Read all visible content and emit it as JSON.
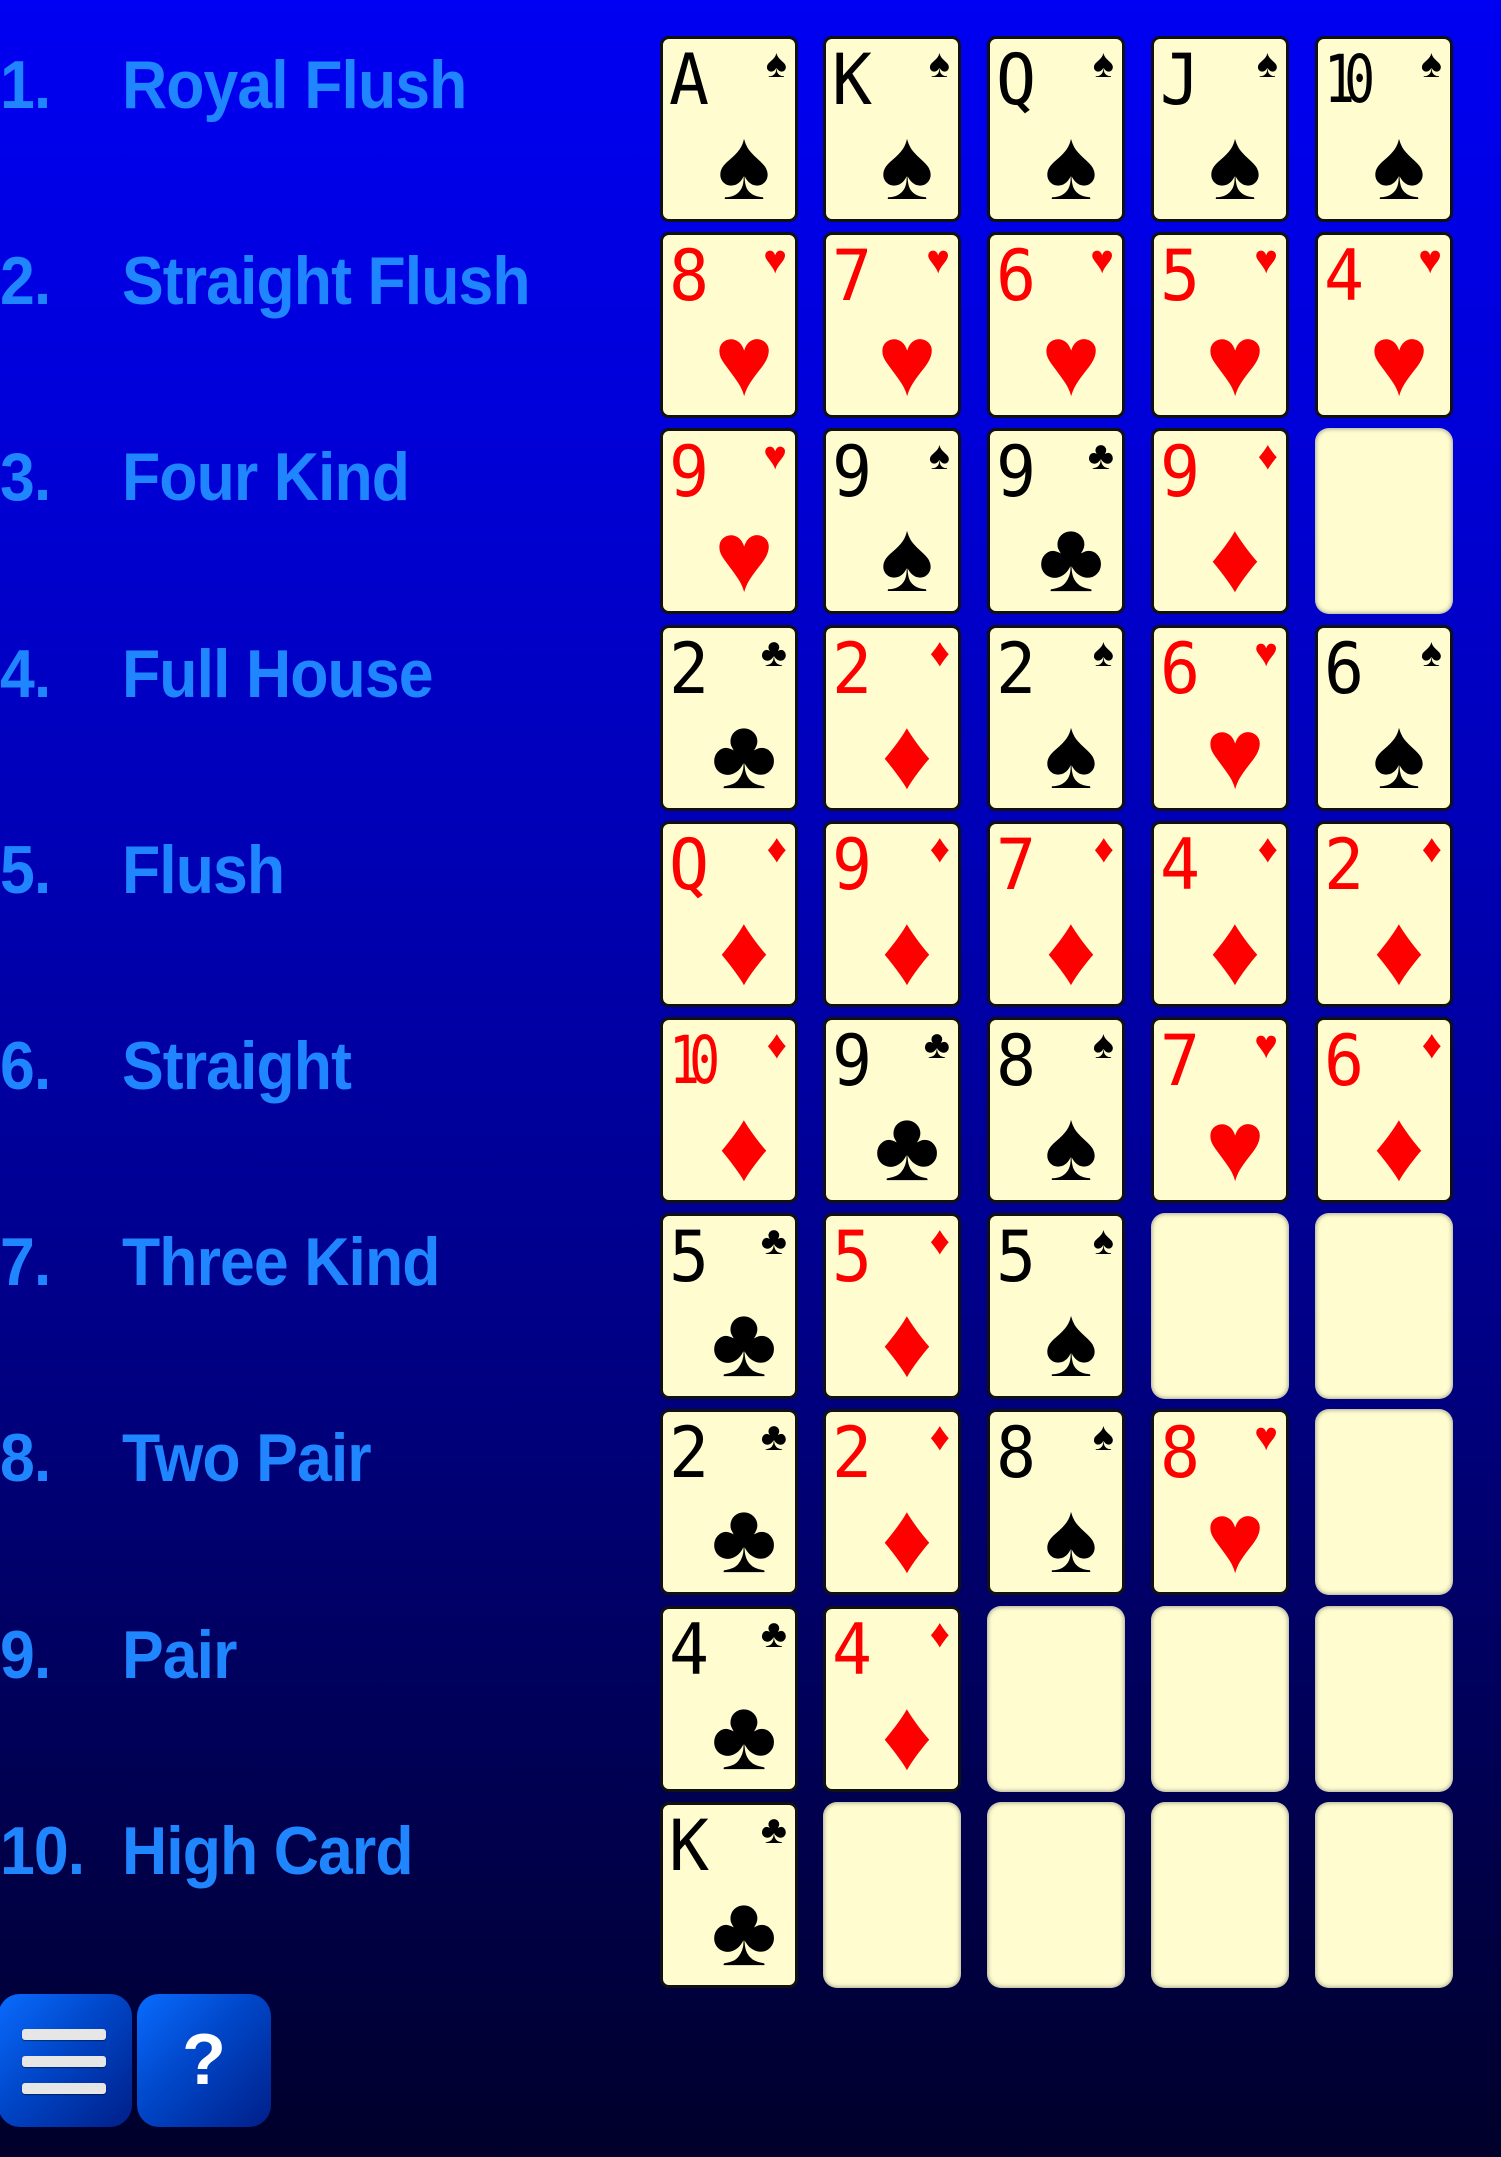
{
  "hands": [
    {
      "number": "1.",
      "name": "Royal Flush",
      "cards": [
        {
          "rank": "A",
          "suit": "spades"
        },
        {
          "rank": "K",
          "suit": "spades"
        },
        {
          "rank": "Q",
          "suit": "spades"
        },
        {
          "rank": "J",
          "suit": "spades"
        },
        {
          "rank": "10",
          "suit": "spades"
        }
      ]
    },
    {
      "number": "2.",
      "name": "Straight Flush",
      "cards": [
        {
          "rank": "8",
          "suit": "hearts"
        },
        {
          "rank": "7",
          "suit": "hearts"
        },
        {
          "rank": "6",
          "suit": "hearts"
        },
        {
          "rank": "5",
          "suit": "hearts"
        },
        {
          "rank": "4",
          "suit": "hearts"
        }
      ]
    },
    {
      "number": "3.",
      "name": "Four Kind",
      "cards": [
        {
          "rank": "9",
          "suit": "hearts"
        },
        {
          "rank": "9",
          "suit": "spades"
        },
        {
          "rank": "9",
          "suit": "clubs"
        },
        {
          "rank": "9",
          "suit": "diamonds"
        },
        null
      ]
    },
    {
      "number": "4.",
      "name": "Full House",
      "cards": [
        {
          "rank": "2",
          "suit": "clubs"
        },
        {
          "rank": "2",
          "suit": "diamonds"
        },
        {
          "rank": "2",
          "suit": "spades"
        },
        {
          "rank": "6",
          "suit": "hearts"
        },
        {
          "rank": "6",
          "suit": "spades"
        }
      ]
    },
    {
      "number": "5.",
      "name": "Flush",
      "cards": [
        {
          "rank": "Q",
          "suit": "diamonds"
        },
        {
          "rank": "9",
          "suit": "diamonds"
        },
        {
          "rank": "7",
          "suit": "diamonds"
        },
        {
          "rank": "4",
          "suit": "diamonds"
        },
        {
          "rank": "2",
          "suit": "diamonds"
        }
      ]
    },
    {
      "number": "6.",
      "name": "Straight",
      "cards": [
        {
          "rank": "10",
          "suit": "diamonds"
        },
        {
          "rank": "9",
          "suit": "clubs"
        },
        {
          "rank": "8",
          "suit": "spades"
        },
        {
          "rank": "7",
          "suit": "hearts"
        },
        {
          "rank": "6",
          "suit": "diamonds"
        }
      ]
    },
    {
      "number": "7.",
      "name": "Three Kind",
      "cards": [
        {
          "rank": "5",
          "suit": "clubs"
        },
        {
          "rank": "5",
          "suit": "diamonds"
        },
        {
          "rank": "5",
          "suit": "spades"
        },
        null,
        null
      ]
    },
    {
      "number": "8.",
      "name": "Two Pair",
      "cards": [
        {
          "rank": "2",
          "suit": "clubs"
        },
        {
          "rank": "2",
          "suit": "diamonds"
        },
        {
          "rank": "8",
          "suit": "spades"
        },
        {
          "rank": "8",
          "suit": "hearts"
        },
        null
      ]
    },
    {
      "number": "9.",
      "name": "Pair",
      "cards": [
        {
          "rank": "4",
          "suit": "clubs"
        },
        {
          "rank": "4",
          "suit": "diamonds"
        },
        null,
        null,
        null
      ]
    },
    {
      "number": "10.",
      "name": "High Card",
      "cards": [
        {
          "rank": "K",
          "suit": "clubs"
        },
        null,
        null,
        null,
        null
      ]
    }
  ],
  "suits": {
    "spades": {
      "glyph": "♠",
      "color": "black",
      "icon": "spade-icon"
    },
    "hearts": {
      "glyph": "♥",
      "color": "red",
      "icon": "heart-icon"
    },
    "diamonds": {
      "glyph": "♦",
      "color": "red",
      "icon": "diamond-icon"
    },
    "clubs": {
      "glyph": "♣",
      "color": "black",
      "icon": "club-icon"
    }
  },
  "colors": {
    "label": "#1f86ff",
    "card_face": "#fffdcf",
    "red_suit": "#ff0000",
    "black_suit": "#000000"
  },
  "buttons": {
    "menu": {
      "icon": "hamburger-menu-icon"
    },
    "help": {
      "label": "?",
      "icon": "question-mark-icon"
    }
  }
}
